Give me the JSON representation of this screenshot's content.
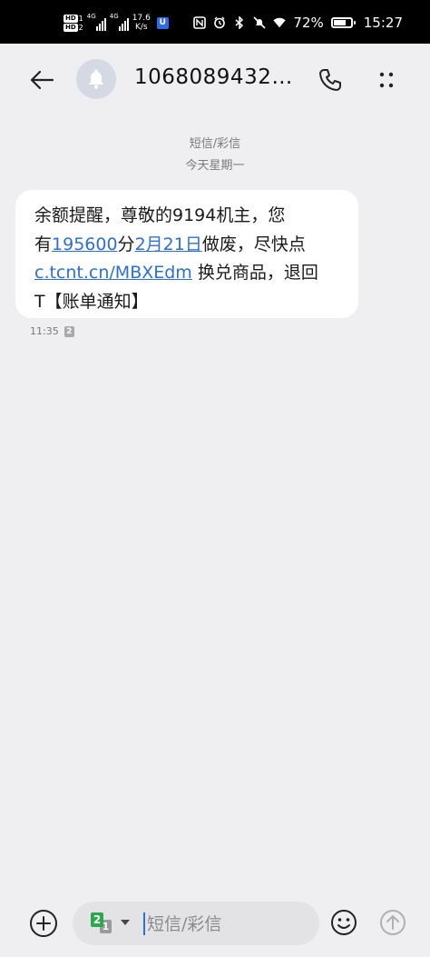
{
  "status_bar": {
    "hd_label": "HD",
    "sim1": "1",
    "sim2": "2",
    "network1": "4G",
    "network2": "4G",
    "speed_value": "17.6",
    "speed_unit": "K/s",
    "app_badge": "U",
    "battery_percent": "72%",
    "battery_level": 0.72,
    "time": "15:27",
    "icons": [
      "nfc-icon",
      "alarm-icon",
      "bluetooth-icon",
      "mute-icon",
      "wifi-icon"
    ]
  },
  "header": {
    "contact_number": "1068089432…",
    "back_icon": "arrow-left-icon",
    "avatar_icon": "bell-icon",
    "call_icon": "phone-icon",
    "more_icon": "more-vertical-icon"
  },
  "thread": {
    "type_label": "短信/彩信",
    "date_label": "今天星期一"
  },
  "message": {
    "line1": "余额提醒，尊敬的9194机主，您",
    "line2_prefix": "有",
    "line2_link1": "195600",
    "line2_mid": "分",
    "line2_link2": "2月21日",
    "line2_suffix": "做废，尽快点",
    "line3_link": "c.tcnt.cn/MBXEdm",
    "line3_suffix": " 换兑商品，退回",
    "line4": "T【账单通知】",
    "time": "11:35",
    "sim_badge": "2"
  },
  "compose": {
    "placeholder": "短信/彩信",
    "value": "",
    "sim_primary": "2",
    "sim_secondary": "1",
    "add_icon": "plus-circle-icon",
    "emoji_icon": "emoji-icon",
    "send_icon": "send-arrow-icon"
  },
  "colors": {
    "background": "#efeff1",
    "bubble": "#ffffff",
    "link": "#2a6fdb",
    "sim_green": "#2aa84a",
    "avatar_bg": "#d5d9e3"
  }
}
